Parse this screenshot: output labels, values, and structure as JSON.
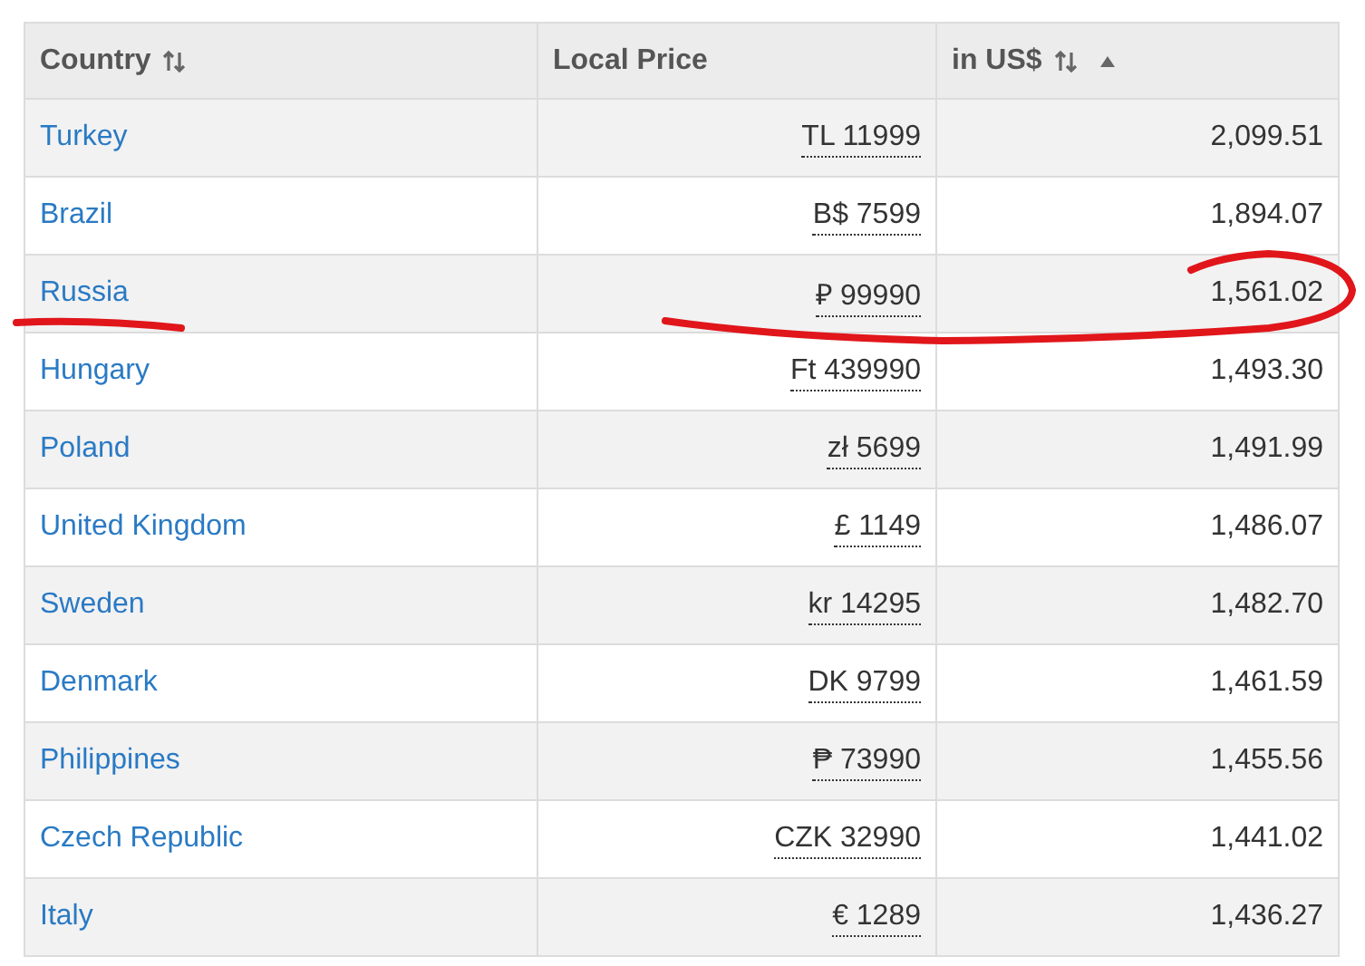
{
  "table": {
    "columns": [
      {
        "label": "Country",
        "sortable": true,
        "sorted": false
      },
      {
        "label": "Local Price",
        "sortable": false,
        "sorted": false
      },
      {
        "label": "in US$",
        "sortable": true,
        "sorted": true
      }
    ],
    "rows": [
      {
        "country": "Turkey",
        "local_price": "TL 11999",
        "usd": "2,099.51"
      },
      {
        "country": "Brazil",
        "local_price": "B$ 7599",
        "usd": "1,894.07"
      },
      {
        "country": "Russia",
        "local_price": "₽ 99990",
        "usd": "1,561.02"
      },
      {
        "country": "Hungary",
        "local_price": "Ft 439990",
        "usd": "1,493.30"
      },
      {
        "country": "Poland",
        "local_price": "zł 5699",
        "usd": "1,491.99"
      },
      {
        "country": "United Kingdom",
        "local_price": "£ 1149",
        "usd": "1,486.07"
      },
      {
        "country": "Sweden",
        "local_price": "kr 14295",
        "usd": "1,482.70"
      },
      {
        "country": "Denmark",
        "local_price": "DK 9799",
        "usd": "1,461.59"
      },
      {
        "country": "Philippines",
        "local_price": "₱ 73990",
        "usd": "1,455.56"
      },
      {
        "country": "Czech Republic",
        "local_price": "CZK 32990",
        "usd": "1,441.02"
      },
      {
        "country": "Italy",
        "local_price": "€ 1289",
        "usd": "1,436.27"
      }
    ]
  }
}
